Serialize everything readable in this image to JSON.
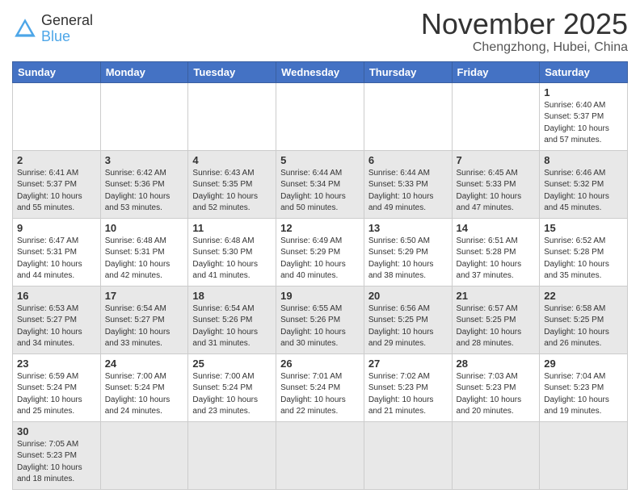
{
  "header": {
    "logo_general": "General",
    "logo_blue": "Blue",
    "month_title": "November 2025",
    "subtitle": "Chengzhong, Hubei, China"
  },
  "days_of_week": [
    "Sunday",
    "Monday",
    "Tuesday",
    "Wednesday",
    "Thursday",
    "Friday",
    "Saturday"
  ],
  "weeks": [
    [
      {
        "day": "",
        "info": ""
      },
      {
        "day": "",
        "info": ""
      },
      {
        "day": "",
        "info": ""
      },
      {
        "day": "",
        "info": ""
      },
      {
        "day": "",
        "info": ""
      },
      {
        "day": "",
        "info": ""
      },
      {
        "day": "1",
        "info": "Sunrise: 6:40 AM\nSunset: 5:37 PM\nDaylight: 10 hours and 57 minutes."
      }
    ],
    [
      {
        "day": "2",
        "info": "Sunrise: 6:41 AM\nSunset: 5:37 PM\nDaylight: 10 hours and 55 minutes."
      },
      {
        "day": "3",
        "info": "Sunrise: 6:42 AM\nSunset: 5:36 PM\nDaylight: 10 hours and 53 minutes."
      },
      {
        "day": "4",
        "info": "Sunrise: 6:43 AM\nSunset: 5:35 PM\nDaylight: 10 hours and 52 minutes."
      },
      {
        "day": "5",
        "info": "Sunrise: 6:44 AM\nSunset: 5:34 PM\nDaylight: 10 hours and 50 minutes."
      },
      {
        "day": "6",
        "info": "Sunrise: 6:44 AM\nSunset: 5:33 PM\nDaylight: 10 hours and 49 minutes."
      },
      {
        "day": "7",
        "info": "Sunrise: 6:45 AM\nSunset: 5:33 PM\nDaylight: 10 hours and 47 minutes."
      },
      {
        "day": "8",
        "info": "Sunrise: 6:46 AM\nSunset: 5:32 PM\nDaylight: 10 hours and 45 minutes."
      }
    ],
    [
      {
        "day": "9",
        "info": "Sunrise: 6:47 AM\nSunset: 5:31 PM\nDaylight: 10 hours and 44 minutes."
      },
      {
        "day": "10",
        "info": "Sunrise: 6:48 AM\nSunset: 5:31 PM\nDaylight: 10 hours and 42 minutes."
      },
      {
        "day": "11",
        "info": "Sunrise: 6:48 AM\nSunset: 5:30 PM\nDaylight: 10 hours and 41 minutes."
      },
      {
        "day": "12",
        "info": "Sunrise: 6:49 AM\nSunset: 5:29 PM\nDaylight: 10 hours and 40 minutes."
      },
      {
        "day": "13",
        "info": "Sunrise: 6:50 AM\nSunset: 5:29 PM\nDaylight: 10 hours and 38 minutes."
      },
      {
        "day": "14",
        "info": "Sunrise: 6:51 AM\nSunset: 5:28 PM\nDaylight: 10 hours and 37 minutes."
      },
      {
        "day": "15",
        "info": "Sunrise: 6:52 AM\nSunset: 5:28 PM\nDaylight: 10 hours and 35 minutes."
      }
    ],
    [
      {
        "day": "16",
        "info": "Sunrise: 6:53 AM\nSunset: 5:27 PM\nDaylight: 10 hours and 34 minutes."
      },
      {
        "day": "17",
        "info": "Sunrise: 6:54 AM\nSunset: 5:27 PM\nDaylight: 10 hours and 33 minutes."
      },
      {
        "day": "18",
        "info": "Sunrise: 6:54 AM\nSunset: 5:26 PM\nDaylight: 10 hours and 31 minutes."
      },
      {
        "day": "19",
        "info": "Sunrise: 6:55 AM\nSunset: 5:26 PM\nDaylight: 10 hours and 30 minutes."
      },
      {
        "day": "20",
        "info": "Sunrise: 6:56 AM\nSunset: 5:25 PM\nDaylight: 10 hours and 29 minutes."
      },
      {
        "day": "21",
        "info": "Sunrise: 6:57 AM\nSunset: 5:25 PM\nDaylight: 10 hours and 28 minutes."
      },
      {
        "day": "22",
        "info": "Sunrise: 6:58 AM\nSunset: 5:25 PM\nDaylight: 10 hours and 26 minutes."
      }
    ],
    [
      {
        "day": "23",
        "info": "Sunrise: 6:59 AM\nSunset: 5:24 PM\nDaylight: 10 hours and 25 minutes."
      },
      {
        "day": "24",
        "info": "Sunrise: 7:00 AM\nSunset: 5:24 PM\nDaylight: 10 hours and 24 minutes."
      },
      {
        "day": "25",
        "info": "Sunrise: 7:00 AM\nSunset: 5:24 PM\nDaylight: 10 hours and 23 minutes."
      },
      {
        "day": "26",
        "info": "Sunrise: 7:01 AM\nSunset: 5:24 PM\nDaylight: 10 hours and 22 minutes."
      },
      {
        "day": "27",
        "info": "Sunrise: 7:02 AM\nSunset: 5:23 PM\nDaylight: 10 hours and 21 minutes."
      },
      {
        "day": "28",
        "info": "Sunrise: 7:03 AM\nSunset: 5:23 PM\nDaylight: 10 hours and 20 minutes."
      },
      {
        "day": "29",
        "info": "Sunrise: 7:04 AM\nSunset: 5:23 PM\nDaylight: 10 hours and 19 minutes."
      }
    ],
    [
      {
        "day": "30",
        "info": "Sunrise: 7:05 AM\nSunset: 5:23 PM\nDaylight: 10 hours and 18 minutes."
      },
      {
        "day": "",
        "info": ""
      },
      {
        "day": "",
        "info": ""
      },
      {
        "day": "",
        "info": ""
      },
      {
        "day": "",
        "info": ""
      },
      {
        "day": "",
        "info": ""
      },
      {
        "day": "",
        "info": ""
      }
    ]
  ],
  "alt_rows": [
    1,
    3,
    5
  ]
}
